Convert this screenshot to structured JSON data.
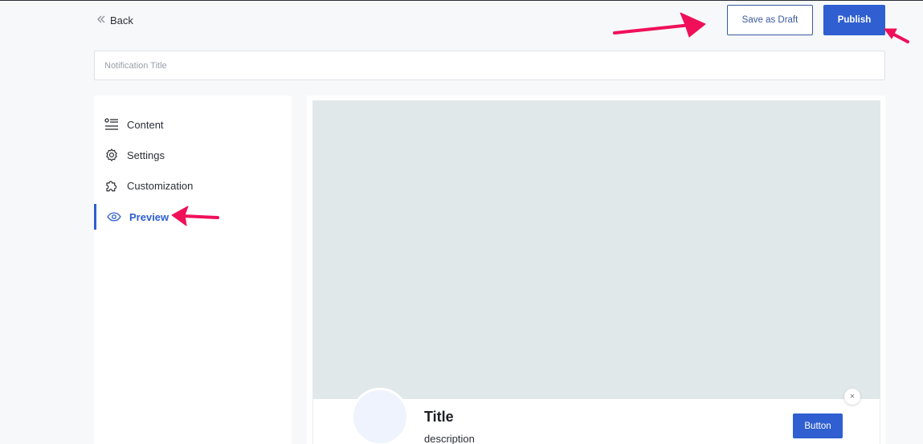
{
  "header": {
    "back_label": "Back",
    "save_draft_label": "Save as Draft",
    "publish_label": "Publish"
  },
  "title_input": {
    "placeholder": "Notification Title",
    "value": ""
  },
  "sidebar": {
    "items": [
      {
        "label": "Content",
        "icon": "list-icon",
        "active": false
      },
      {
        "label": "Settings",
        "icon": "gear-icon",
        "active": false
      },
      {
        "label": "Customization",
        "icon": "puzzle-icon",
        "active": false
      },
      {
        "label": "Preview",
        "icon": "eye-icon",
        "active": true
      }
    ]
  },
  "preview": {
    "title": "Title",
    "description": "description",
    "button_label": "Button",
    "close_glyph": "×"
  },
  "colors": {
    "accent": "#2f5fd0",
    "annotation_arrow": "#f0105a",
    "image_placeholder": "#e1e8ea"
  }
}
